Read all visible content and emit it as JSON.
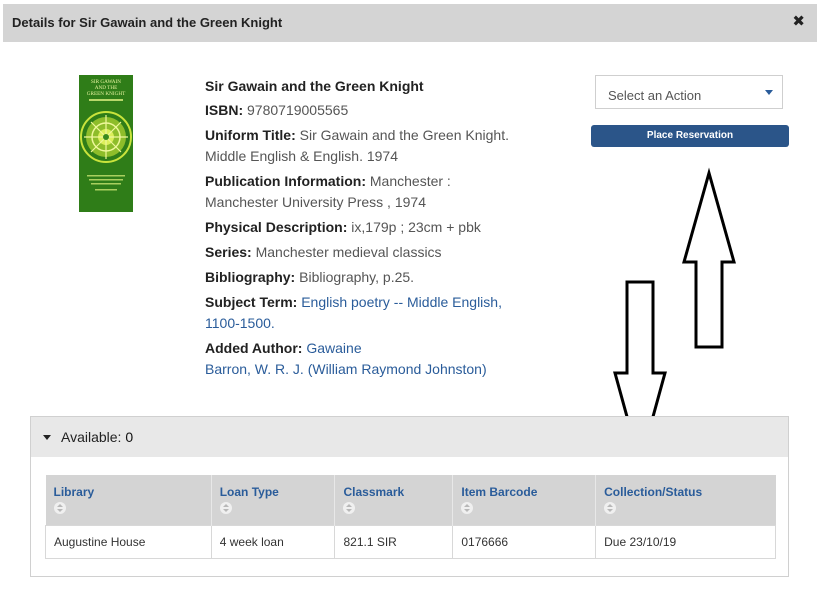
{
  "dialog": {
    "title": "Details for Sir Gawain and the Green Knight",
    "close_symbol": "✖"
  },
  "cover": {
    "title_text": "SIR GAWAIN AND THE GREEN KNIGHT",
    "colors": {
      "background": "#2f7d18",
      "art": "#c9e33c"
    }
  },
  "record": {
    "title": "Sir Gawain and the Green Knight",
    "isbn_label": "ISBN:",
    "isbn": "9780719005565",
    "uniform_title_label": "Uniform Title:",
    "uniform_title": "Sir Gawain and the Green Knight. Middle English & English. 1974",
    "publication_label": "Publication Information:",
    "publication": "Manchester : Manchester University Press , 1974",
    "physical_label": "Physical Description:",
    "physical": "ix,179p ; 23cm + pbk",
    "series_label": "Series:",
    "series": "Manchester medieval classics",
    "bibliography_label": "Bibliography:",
    "bibliography": "Bibliography, p.25.",
    "subject_label": "Subject Term:",
    "subject": "English poetry -- Middle English, 1100-1500.",
    "added_author_label": "Added Author:",
    "added_authors": [
      "Gawaine",
      "Barron, W. R. J. (William Raymond Johnston)"
    ]
  },
  "actions": {
    "select_placeholder": "Select an Action",
    "place_reservation": "Place Reservation"
  },
  "availability": {
    "label": "Available:",
    "count": "0",
    "columns": [
      "Library",
      "Loan Type",
      "Classmark",
      "Item Barcode",
      "Collection/Status"
    ],
    "rows": [
      [
        "Augustine House",
        "4 week loan",
        "821.1 SIR",
        "0176666",
        "Due 23/10/19"
      ]
    ]
  },
  "colors": {
    "header_bg": "#d4d4d4",
    "link": "#2a5c9a",
    "button_bg": "#2b5589"
  }
}
